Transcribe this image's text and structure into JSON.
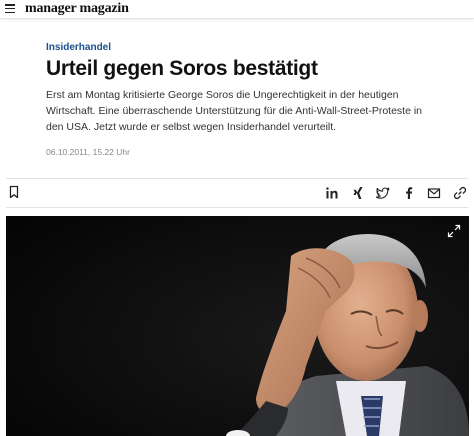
{
  "site": {
    "logo_text": "manager magazin",
    "icons": {
      "menu": "hamburger-menu-icon"
    }
  },
  "article": {
    "kicker": "Insiderhandel",
    "headline": "Urteil gegen Soros bestätigt",
    "teaser": "Erst am Montag kritisierte George Soros die Ungerechtigkeit in der heutigen Wirtschaft. Eine überraschende Unterstützung für die Anti-Wall-Street-Proteste in den USA. Jetzt wurde er selbst wegen Insiderhandel verurteilt.",
    "dateline": "06.10.2011, 15.22 Uhr"
  },
  "share": {
    "icons": [
      "bookmark-icon",
      "linkedin-icon",
      "xing-icon",
      "twitter-icon",
      "facebook-icon",
      "email-icon",
      "link-icon"
    ]
  },
  "hero": {
    "icons": {
      "expand": "expand-icon"
    }
  },
  "colors": {
    "kicker": "#1b4f8f",
    "text": "#111111",
    "muted": "#888888",
    "divider": "#e3e3e3",
    "hero_background": "#0b0b0b"
  }
}
